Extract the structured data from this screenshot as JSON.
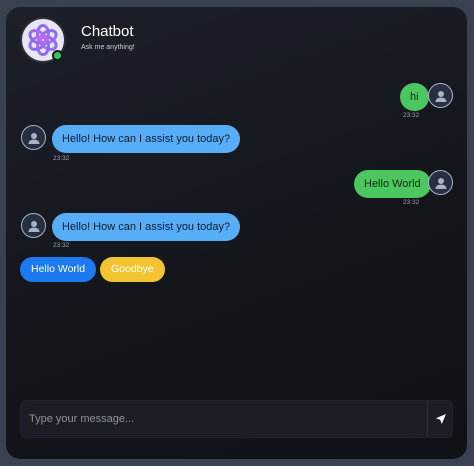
{
  "header": {
    "title": "Chatbot",
    "subtitle": "Ask me anything!",
    "avatar_icon": "openai-logo-icon",
    "status": "online",
    "status_color": "#3ec45a"
  },
  "messages": [
    {
      "sender": "user",
      "text": "hi",
      "time": "23:32"
    },
    {
      "sender": "bot",
      "text": "Hello! How can I assist you today?",
      "time": "23:32"
    },
    {
      "sender": "user",
      "text": "Hello World",
      "time": "23:32"
    },
    {
      "sender": "bot",
      "text": "Hello! How can I assist you today?",
      "time": "23:32"
    }
  ],
  "quick_replies": [
    {
      "label": "Hello World",
      "color": "#1d79f0"
    },
    {
      "label": "Goodbye",
      "color": "#f3c431"
    }
  ],
  "composer": {
    "placeholder": "Type your message...",
    "value": "",
    "send_icon": "send-icon"
  },
  "colors": {
    "user_bubble": "#4cc65e",
    "bot_bubble": "#58adf7",
    "background": "#14161c"
  }
}
